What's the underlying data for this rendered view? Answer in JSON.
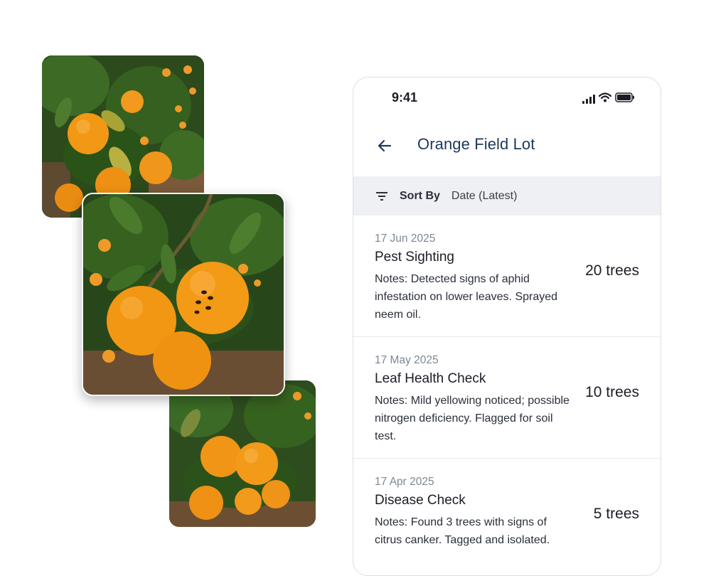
{
  "collage": {
    "photos": [
      {
        "name": "orange-tree-photo-top",
        "subject": "orange tree with ripe fruit and spotted leaves"
      },
      {
        "name": "orange-tree-photo-center",
        "subject": "oranges with aphid damage on branch"
      },
      {
        "name": "orange-tree-photo-bottom",
        "subject": "orange cluster on tree"
      }
    ]
  },
  "status_bar": {
    "time": "9:41",
    "icons": [
      "signal-icon",
      "wifi-icon",
      "battery-icon"
    ]
  },
  "header": {
    "back_icon": "arrow-left-icon",
    "title": "Orange Field Lot"
  },
  "sort": {
    "icon": "filter-icon",
    "label": "Sort By",
    "value": "Date (Latest)"
  },
  "entries": [
    {
      "date": "17 Jun 2025",
      "title": "Pest Sighting",
      "notes": "Notes: Detected signs of aphid infestation on lower leaves. Sprayed neem oil.",
      "count": "20 trees"
    },
    {
      "date": "17 May 2025",
      "title": "Leaf Health Check",
      "notes": "Notes: Mild yellowing noticed; possible nitrogen deficiency. Flagged for soil test.",
      "count": "10 trees"
    },
    {
      "date": "17 Apr 2025",
      "title": "Disease Check",
      "notes": "Notes: Found 3 trees with signs of citrus canker. Tagged and isolated.",
      "count": "5 trees"
    }
  ],
  "colors": {
    "title_blue": "#1b3a5c",
    "sort_bar_bg": "#eef0f3",
    "date_gray": "#7c8795",
    "fruit_orange": "#f39a16",
    "leaf_green": "#2e5a1c"
  }
}
